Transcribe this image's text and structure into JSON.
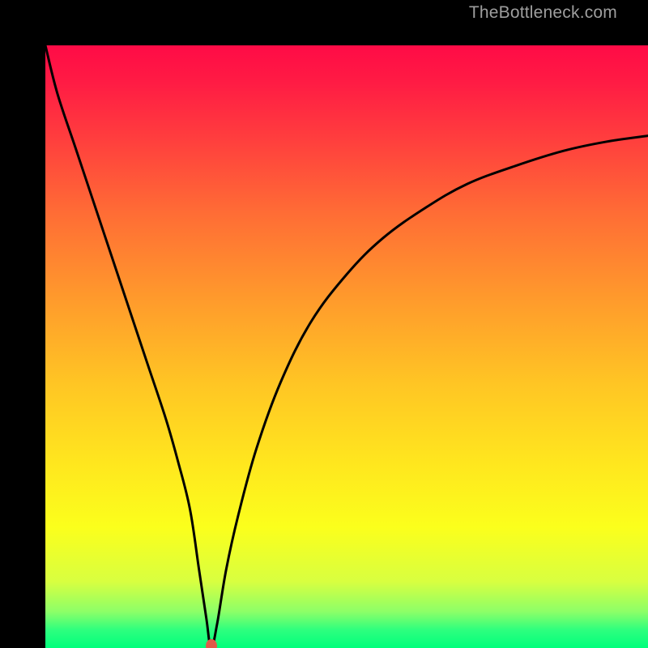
{
  "watermark": "TheBottleneck.com",
  "dot": {
    "x_pct": 27.5,
    "y_pct": 100
  },
  "colors": {
    "curve": "#000000",
    "dot": "#e05a4a",
    "frame": "#000000",
    "watermark": "#9e9e9e"
  },
  "chart_data": {
    "type": "line",
    "title": "",
    "xlabel": "",
    "ylabel": "",
    "xlim": [
      0,
      100
    ],
    "ylim": [
      0,
      100
    ],
    "grid": false,
    "legend": false,
    "annotations": [
      "TheBottleneck.com"
    ],
    "series": [
      {
        "name": "bottleneck-curve",
        "x": [
          0,
          2,
          5,
          8,
          11,
          14,
          17,
          20,
          22,
          24,
          25.5,
          26.7,
          27.5,
          28.5,
          30,
          32,
          35,
          39,
          44,
          50,
          56,
          63,
          70,
          78,
          86,
          93,
          100
        ],
        "values": [
          100,
          92,
          83,
          74,
          65,
          56,
          47,
          38,
          31,
          23,
          13,
          5,
          0,
          4,
          13,
          22,
          33,
          44,
          54,
          62,
          68,
          73,
          77,
          80,
          82.5,
          84,
          85
        ]
      }
    ],
    "marker": {
      "x": 27.5,
      "y": 0,
      "color": "#e05a4a"
    },
    "background_gradient": {
      "direction": "top-to-bottom",
      "stops": [
        {
          "pos": 0,
          "color": "#ff0b46"
        },
        {
          "pos": 28,
          "color": "#ff6d35"
        },
        {
          "pos": 56,
          "color": "#ffc524"
        },
        {
          "pos": 80,
          "color": "#fbff1c"
        },
        {
          "pos": 97,
          "color": "#2eff7e"
        },
        {
          "pos": 100,
          "color": "#00ff7c"
        }
      ]
    }
  }
}
